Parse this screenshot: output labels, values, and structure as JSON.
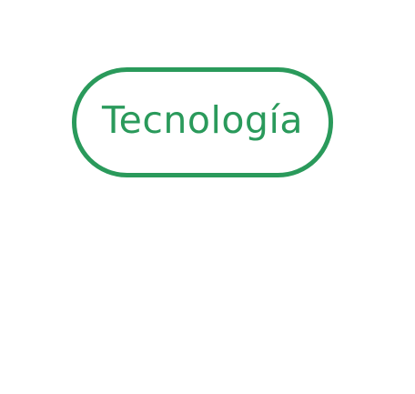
{
  "chip": {
    "label": "Tecnología",
    "color": "#2a9a5b"
  }
}
